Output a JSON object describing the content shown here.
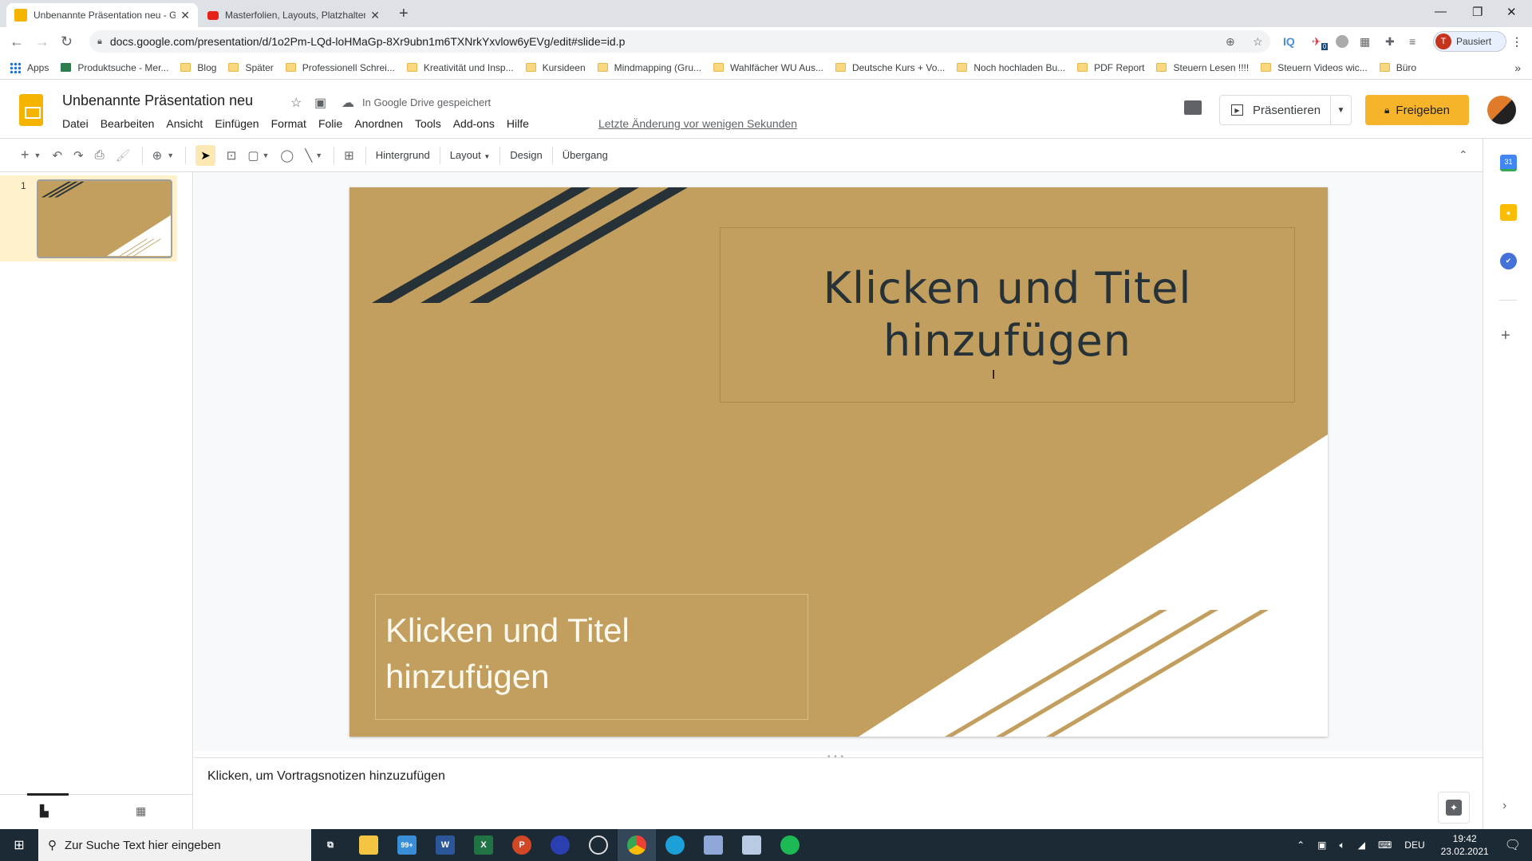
{
  "browser": {
    "tabs": [
      {
        "title": "Unbenannte Präsentation neu - G",
        "favicon": "slides-icon",
        "active": true
      },
      {
        "title": "Masterfolien, Layouts, Platzhalter",
        "favicon": "youtube-icon",
        "active": false
      }
    ],
    "url": "docs.google.com/presentation/d/1o2Pm-LQd-loHMaGp-8Xr9ubn1m6TXNrkYxvlow6yEVg/edit#slide=id.p",
    "profile_label": "Pausiert",
    "profile_initial": "T",
    "extension_badge": "0",
    "bookmarks": [
      "Apps",
      "Produktsuche - Mer...",
      "Blog",
      "Später",
      "Professionell Schrei...",
      "Kreativität und Insp...",
      "Kursideen",
      "Mindmapping  (Gru...",
      "Wahlfächer WU Aus...",
      "Deutsche Kurs + Vo...",
      "Noch hochladen Bu...",
      "PDF Report",
      "Steuern Lesen !!!!",
      "Steuern Videos wic...",
      "Büro"
    ]
  },
  "docs": {
    "title": "Unbenannte Präsentation neu",
    "saved_status": "In Google Drive gespeichert",
    "menus": [
      "Datei",
      "Bearbeiten",
      "Ansicht",
      "Einfügen",
      "Format",
      "Folie",
      "Anordnen",
      "Tools",
      "Add-ons",
      "Hilfe"
    ],
    "last_edit": "Letzte Änderung vor wenigen Sekunden",
    "present_label": "Präsentieren",
    "share_label": "Freigeben",
    "toolbar": {
      "background_label": "Hintergrund",
      "layout_label": "Layout",
      "design_label": "Design",
      "transition_label": "Übergang"
    },
    "slide_number": "1",
    "slide": {
      "title_placeholder": "Klicken und Titel hinzufügen",
      "subtitle_placeholder": "Klicken und Titel hinzufügen",
      "background_color": "#c29f5e",
      "stripe_dark_color": "#263238",
      "corner_color": "#ffffff"
    },
    "notes_placeholder": "Klicken, um Vortragsnotizen hinzuzufügen"
  },
  "taskbar": {
    "search_placeholder": "Zur Suche Text hier eingeben",
    "mail_badge": "99+",
    "language": "DEU",
    "time": "19:42",
    "date": "23.02.2021"
  }
}
